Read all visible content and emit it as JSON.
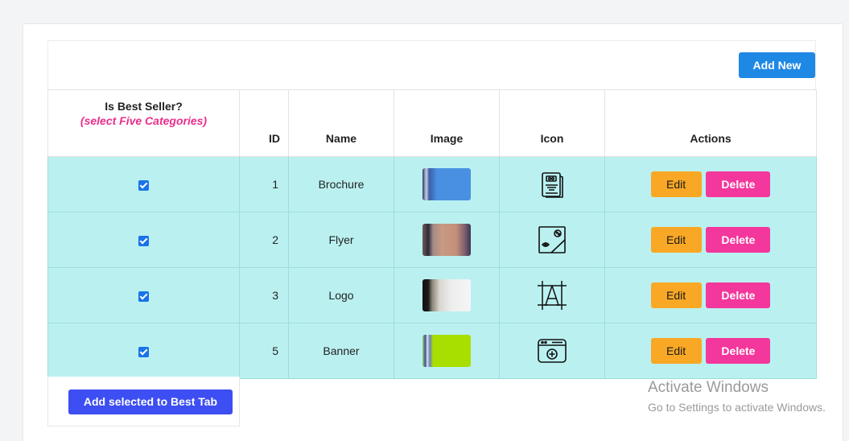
{
  "toolbar": {
    "add_new_label": "Add New"
  },
  "table": {
    "headers": {
      "best_seller": "Is Best Seller?",
      "best_seller_hint": "(select Five Categories)",
      "id": "ID",
      "name": "Name",
      "image": "Image",
      "icon": "Icon",
      "actions": "Actions"
    },
    "rows": [
      {
        "checked": true,
        "id": "1",
        "name": "Brochure",
        "image": "brochure-thumbnail",
        "icon": "brochure-icon",
        "edit_label": "Edit",
        "delete_label": "Delete"
      },
      {
        "checked": true,
        "id": "2",
        "name": "Flyer",
        "image": "flyer-thumbnail",
        "icon": "flyer-icon",
        "edit_label": "Edit",
        "delete_label": "Delete"
      },
      {
        "checked": true,
        "id": "3",
        "name": "Logo",
        "image": "logo-thumbnail",
        "icon": "logo-icon",
        "edit_label": "Edit",
        "delete_label": "Delete"
      },
      {
        "checked": true,
        "id": "5",
        "name": "Banner",
        "image": "banner-thumbnail",
        "icon": "banner-icon",
        "edit_label": "Edit",
        "delete_label": "Delete"
      }
    ]
  },
  "footer": {
    "add_best_label": "Add selected to Best Tab"
  },
  "watermark": {
    "title": "Activate Windows",
    "subtitle": "Go to Settings to activate Windows."
  },
  "colors": {
    "row_bg": "#baf1f0",
    "add_new": "#1e88e5",
    "edit": "#f9a825",
    "delete": "#f4379c",
    "best_tab": "#3d4ef2",
    "hint": "#ea2e8d"
  }
}
